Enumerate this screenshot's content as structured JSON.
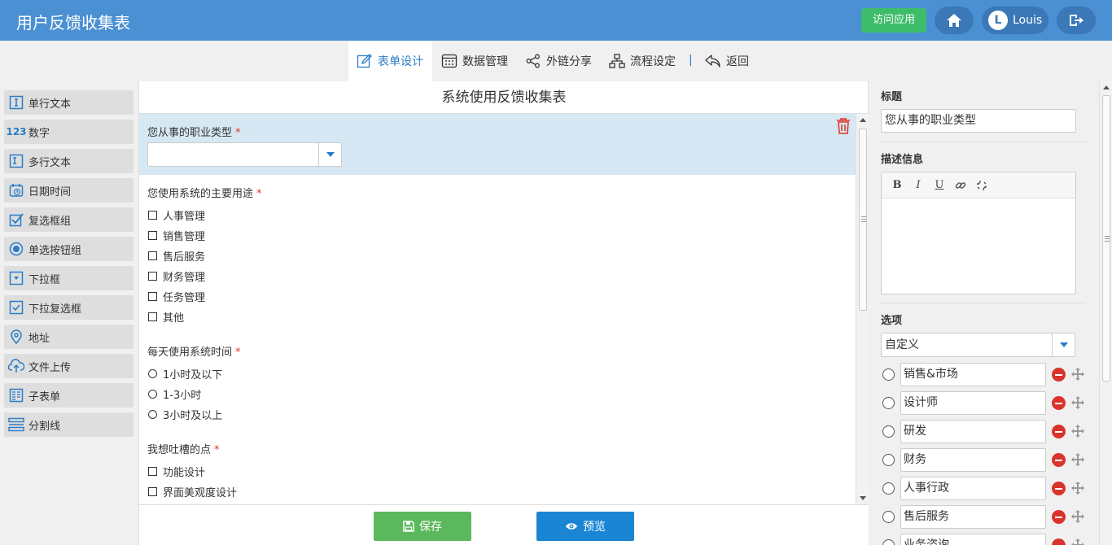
{
  "header": {
    "title": "用户反馈收集表",
    "visit_label": "访问应用",
    "user_initial": "L",
    "user_name": "Louis"
  },
  "toolbar": {
    "form_design": "表单设计",
    "data_manage": "数据管理",
    "share": "外链分享",
    "workflow": "流程设定",
    "separator": "|",
    "back": "返回"
  },
  "components": [
    {
      "label": "单行文本",
      "icon": "single-line-text-icon"
    },
    {
      "label": "数字",
      "icon": "number-icon",
      "glyph": "123"
    },
    {
      "label": "多行文本",
      "icon": "multi-line-text-icon"
    },
    {
      "label": "日期时间",
      "icon": "datetime-icon"
    },
    {
      "label": "复选框组",
      "icon": "checkbox-group-icon"
    },
    {
      "label": "单选按钮组",
      "icon": "radio-group-icon"
    },
    {
      "label": "下拉框",
      "icon": "dropdown-icon"
    },
    {
      "label": "下拉复选框",
      "icon": "dropdown-checkbox-icon"
    },
    {
      "label": "地址",
      "icon": "address-icon"
    },
    {
      "label": "文件上传",
      "icon": "upload-icon"
    },
    {
      "label": "子表单",
      "icon": "subform-icon"
    },
    {
      "label": "分割线",
      "icon": "divider-icon"
    }
  ],
  "form": {
    "title": "系统使用反馈收集表",
    "required_mark": "*",
    "q1": {
      "label": "您从事的职业类型",
      "value": ""
    },
    "q2": {
      "label": "您使用系统的主要用途",
      "options": [
        "人事管理",
        "销售管理",
        "售后服务",
        "财务管理",
        "任务管理",
        "其他"
      ]
    },
    "q3": {
      "label": "每天使用系统时间",
      "options": [
        "1小时及以下",
        "1-3小时",
        "3小时及以上"
      ]
    },
    "q4": {
      "label": "我想吐槽的点",
      "options": [
        "功能设计",
        "界面美观度设计"
      ]
    }
  },
  "footer": {
    "save_label": "保存",
    "preview_label": "预览"
  },
  "props": {
    "title_label": "标题",
    "title_value": "您从事的职业类型",
    "desc_label": "描述信息",
    "editor_bold": "B",
    "editor_italic": "I",
    "editor_underline": "U",
    "options_label": "选项",
    "options_source": "自定义",
    "option_items": [
      "销售&市场",
      "设计师",
      "研发",
      "财务",
      "人事行政",
      "售后服务",
      "业务咨询"
    ]
  },
  "colors": {
    "header_bg": "#4a90d2",
    "accent": "#2a7cc8",
    "visit_green": "#3dbc6a",
    "save_green": "#5cb85c",
    "preview_blue": "#1a85d4",
    "selected_bg": "#d5e8f3",
    "required_red": "#e0352b"
  }
}
